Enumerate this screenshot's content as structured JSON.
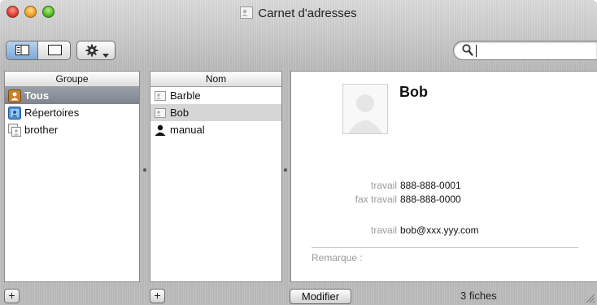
{
  "window": {
    "title": "Carnet d'adresses",
    "accent_color": "#7ea7d7"
  },
  "toolbar": {
    "view_icons": [
      "card-and-columns-icon",
      "card-only-icon"
    ],
    "action_icon": "gear-icon",
    "search": {
      "value": "",
      "placeholder": ""
    }
  },
  "group_column": {
    "header": "Groupe",
    "items": [
      {
        "label": "Tous",
        "icon": "all-contacts-group-icon",
        "selected": true
      },
      {
        "label": "Répertoires",
        "icon": "directories-group-icon",
        "selected": false
      },
      {
        "label": "brother",
        "icon": "group-icon",
        "selected": false
      }
    ]
  },
  "name_column": {
    "header": "Nom",
    "items": [
      {
        "label": "Barble",
        "icon": "card-icon",
        "selected": false
      },
      {
        "label": "Bob",
        "icon": "card-icon",
        "selected": true
      },
      {
        "label": "manual",
        "icon": "person-icon",
        "selected": false
      }
    ]
  },
  "card": {
    "name": "Bob",
    "fields": [
      {
        "label": "travail",
        "value": "888-888-0001"
      },
      {
        "label": "fax travail",
        "value": "888-888-0000"
      },
      {
        "label": "travail",
        "value": "bob@xxx.yyy.com"
      }
    ],
    "note_label": "Remarque :"
  },
  "bottom_bar": {
    "add_group_label": "+",
    "add_person_label": "+",
    "modify_label": "Modifier",
    "count_text": "3 fiches"
  }
}
